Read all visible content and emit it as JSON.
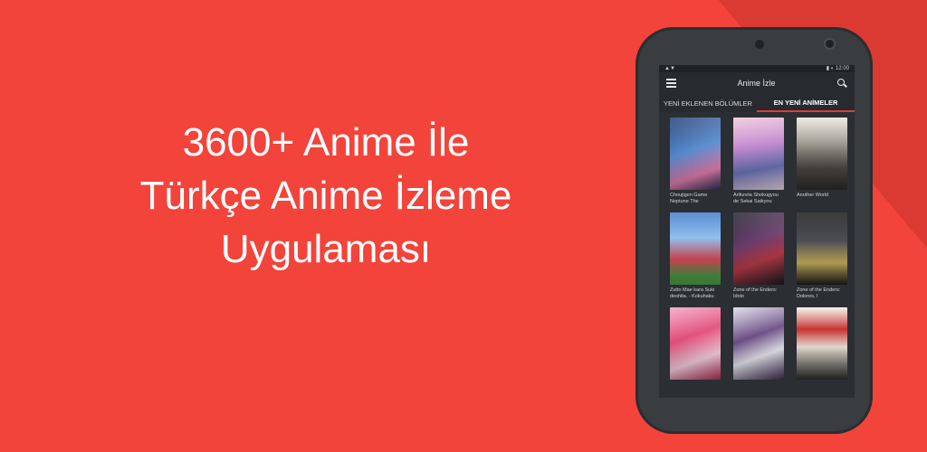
{
  "headline": {
    "line1": "3600+ Anime İle",
    "line2": "Türkçe Anime İzleme",
    "line3": "Uygulaması"
  },
  "phone": {
    "status_left": "▲▼",
    "status_right": "▮ ◐ 12:00",
    "appbar": {
      "menu_icon": "hamburger-icon",
      "title": "Anime İzle",
      "search_icon": "search-icon"
    },
    "tabs": [
      {
        "label": "YENİ EKLENEN BÖLÜMLER",
        "active": false
      },
      {
        "label": "EN YENİ ANİMELER",
        "active": true
      }
    ],
    "cards": [
      {
        "caption": "Choujigen Game Neptune The"
      },
      {
        "caption": "Arifureta Shokugyou de Sekai Saikyou"
      },
      {
        "caption": "Another World"
      },
      {
        "caption": "Zutto Mae kara Suki deshita. - Kokuhaku"
      },
      {
        "caption": "Zone of the Enders: Idolo"
      },
      {
        "caption": "Zone of the Enders: Dolores, I"
      },
      {
        "caption": ""
      },
      {
        "caption": ""
      },
      {
        "caption": ""
      }
    ]
  },
  "colors": {
    "background": "#f2443b",
    "phone_body": "#3a3d40",
    "screen": "#2b2e33",
    "tab_indicator": "#e23c35"
  }
}
